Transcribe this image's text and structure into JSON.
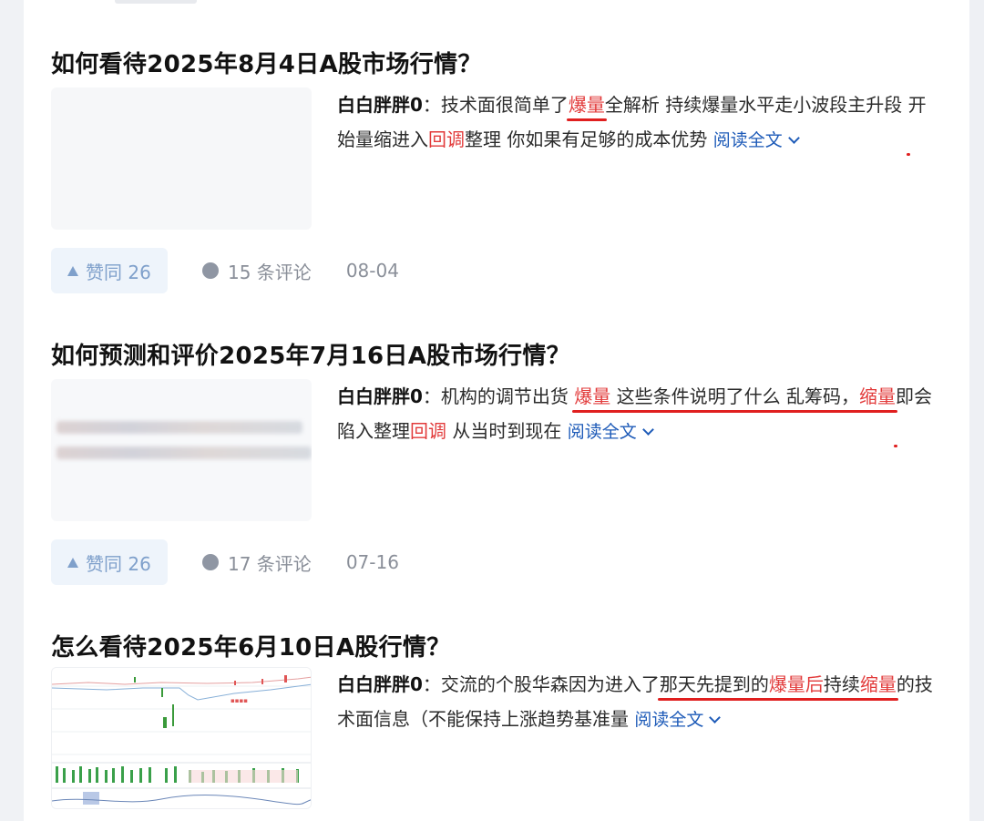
{
  "items": [
    {
      "title": "如何看待2025年8月4日A股市场行情？",
      "author": "白白胖胖0",
      "sep": "：",
      "excerpt_parts": [
        "技术面很简单了",
        "爆量",
        "全解析 持续爆量水平走小波段主升段 ",
        "开始量缩进入",
        "回调",
        "整理",
        " 你如果有足够的成本优势 "
      ],
      "read_more": "阅读全文",
      "votes": "赞同 26",
      "comments": "15 条评论",
      "date": "08-04"
    },
    {
      "title": "如何预测和评价2025年7月16日A股市场行情？",
      "author": "白白胖胖0",
      "sep": "：",
      "excerpt_parts": [
        "机构的调节出货 ",
        "爆量",
        " 这些条件说明了什么 乱筹码，",
        "缩量",
        "即会陷入整理",
        "回调",
        " 从当时到现在 "
      ],
      "read_more": "阅读全文",
      "votes": "赞同 26",
      "comments": "17 条评论",
      "date": "07-16"
    },
    {
      "title": "怎么看待2025年6月10日A股行情？",
      "author": "白白胖胖0",
      "sep": "：",
      "excerpt_parts": [
        "交流的个股华森因为进入了",
        "那天先提到的",
        "爆量后",
        "持续",
        "缩量",
        "的技术面信息（不能保持上涨趋势基准量 "
      ],
      "read_more": "阅读全文"
    }
  ],
  "colors": {
    "highlight": "#e23a3a",
    "underline": "#e01f1f",
    "link": "#1e5bb8",
    "vote_bg": "#eef4fb"
  }
}
